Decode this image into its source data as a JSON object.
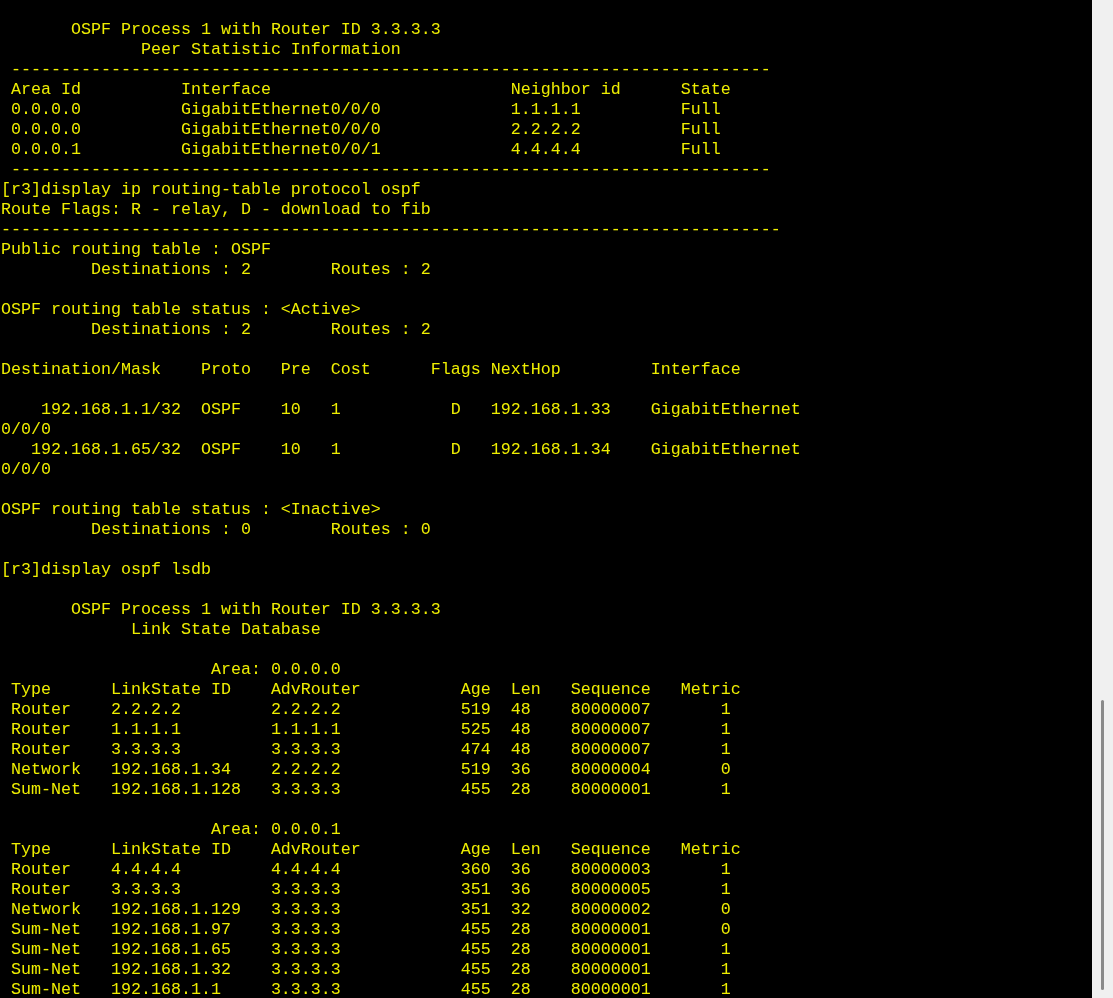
{
  "terminal": {
    "lines": [
      {
        "kind": "text",
        "text": "       OSPF Process 1 with Router ID 3.3.3.3"
      },
      {
        "kind": "text",
        "text": "              Peer Statistic Information"
      },
      {
        "kind": "text",
        "text": " ----------------------------------------------------------------------------"
      },
      {
        "kind": "text",
        "text": " Area Id          Interface                        Neighbor id      State"
      },
      {
        "kind": "text",
        "text": " 0.0.0.0          GigabitEthernet0/0/0             1.1.1.1          Full"
      },
      {
        "kind": "text",
        "text": " 0.0.0.0          GigabitEthernet0/0/0             2.2.2.2          Full"
      },
      {
        "kind": "text",
        "text": " 0.0.0.1          GigabitEthernet0/0/1             4.4.4.4          Full"
      },
      {
        "kind": "text",
        "text": " ----------------------------------------------------------------------------"
      },
      {
        "kind": "text",
        "text": "[r3]display ip routing-table protocol ospf"
      },
      {
        "kind": "text",
        "text": "Route Flags: R - relay, D - download to fib"
      },
      {
        "kind": "text",
        "text": "------------------------------------------------------------------------------"
      },
      {
        "kind": "text",
        "text": "Public routing table : OSPF"
      },
      {
        "kind": "text",
        "text": "         Destinations : 2        Routes : 2"
      },
      {
        "kind": "blank"
      },
      {
        "kind": "text",
        "text": "OSPF routing table status : <Active>"
      },
      {
        "kind": "text",
        "text": "         Destinations : 2        Routes : 2"
      },
      {
        "kind": "blank"
      },
      {
        "kind": "text",
        "text": "Destination/Mask    Proto   Pre  Cost      Flags NextHop         Interface"
      },
      {
        "kind": "blank"
      },
      {
        "kind": "text",
        "text": "    192.168.1.1/32  OSPF    10   1           D   192.168.1.33    GigabitEthernet"
      },
      {
        "kind": "text",
        "text": "0/0/0"
      },
      {
        "kind": "text",
        "text": "   192.168.1.65/32  OSPF    10   1           D   192.168.1.34    GigabitEthernet"
      },
      {
        "kind": "text",
        "text": "0/0/0"
      },
      {
        "kind": "blank"
      },
      {
        "kind": "text",
        "text": "OSPF routing table status : <Inactive>"
      },
      {
        "kind": "text",
        "text": "         Destinations : 0        Routes : 0"
      },
      {
        "kind": "blank"
      },
      {
        "kind": "text",
        "text": "[r3]display ospf lsdb"
      },
      {
        "kind": "blank"
      },
      {
        "kind": "text",
        "text": "       OSPF Process 1 with Router ID 3.3.3.3"
      },
      {
        "kind": "text",
        "text": "             Link State Database"
      },
      {
        "kind": "blank"
      },
      {
        "kind": "text",
        "text": "                     Area: 0.0.0.0"
      },
      {
        "kind": "text",
        "text": " Type      LinkState ID    AdvRouter          Age  Len   Sequence   Metric"
      },
      {
        "kind": "text",
        "text": " Router    2.2.2.2         2.2.2.2            519  48    80000007       1"
      },
      {
        "kind": "text",
        "text": " Router    1.1.1.1         1.1.1.1            525  48    80000007       1"
      },
      {
        "kind": "text",
        "text": " Router    3.3.3.3         3.3.3.3            474  48    80000007       1"
      },
      {
        "kind": "text",
        "text": " Network   192.168.1.34    2.2.2.2            519  36    80000004       0"
      },
      {
        "kind": "text",
        "text": " Sum-Net   192.168.1.128   3.3.3.3            455  28    80000001       1"
      },
      {
        "kind": "blank"
      },
      {
        "kind": "text",
        "text": "                     Area: 0.0.0.1"
      },
      {
        "kind": "text",
        "text": " Type      LinkState ID    AdvRouter          Age  Len   Sequence   Metric"
      },
      {
        "kind": "text",
        "text": " Router    4.4.4.4         4.4.4.4            360  36    80000003       1"
      },
      {
        "kind": "text",
        "text": " Router    3.3.3.3         3.3.3.3            351  36    80000005       1"
      },
      {
        "kind": "text",
        "text": " Network   192.168.1.129   3.3.3.3            351  32    80000002       0"
      },
      {
        "kind": "text",
        "text": " Sum-Net   192.168.1.97    3.3.3.3            455  28    80000001       0"
      },
      {
        "kind": "text",
        "text": " Sum-Net   192.168.1.65    3.3.3.3            455  28    80000001       1"
      },
      {
        "kind": "text",
        "text": " Sum-Net   192.168.1.32    3.3.3.3            455  28    80000001       1"
      },
      {
        "kind": "text",
        "text": " Sum-Net   192.168.1.1     3.3.3.3            455  28    80000001       1"
      }
    ]
  }
}
